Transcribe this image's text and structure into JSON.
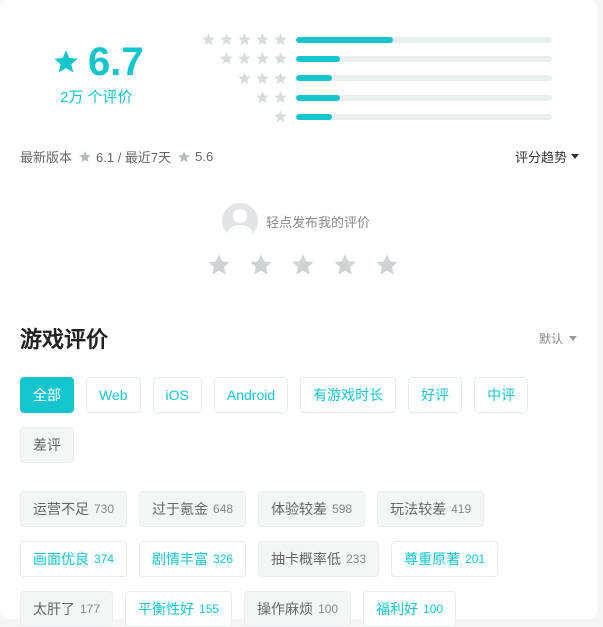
{
  "summary": {
    "score": "6.7",
    "count": "2万 个评价",
    "distribution": [
      {
        "stars": 5,
        "fill": 0.38
      },
      {
        "stars": 4,
        "fill": 0.17
      },
      {
        "stars": 3,
        "fill": 0.14
      },
      {
        "stars": 2,
        "fill": 0.17
      },
      {
        "stars": 1,
        "fill": 0.14
      }
    ]
  },
  "meta": {
    "latest_label": "最新版本",
    "latest_score": "6.1 / 最近7天",
    "recent_score": "5.6",
    "trend_label": "评分趋势"
  },
  "publish": {
    "text": "轻点发布我的评价"
  },
  "reviews": {
    "title": "游戏评价",
    "sort_label": "默认",
    "filters": [
      {
        "label": "全部",
        "style": "active"
      },
      {
        "label": "Web",
        "style": "pos"
      },
      {
        "label": "iOS",
        "style": "pos"
      },
      {
        "label": "Android",
        "style": "pos"
      },
      {
        "label": "有游戏时长",
        "style": "pos"
      },
      {
        "label": "好评",
        "style": "pos"
      },
      {
        "label": "中评",
        "style": "pos"
      },
      {
        "label": "差评",
        "style": "neg"
      }
    ],
    "tags": [
      {
        "label": "运营不足",
        "count": "730",
        "style": "neg"
      },
      {
        "label": "过于氪金",
        "count": "648",
        "style": "neg"
      },
      {
        "label": "体验较差",
        "count": "598",
        "style": "neg"
      },
      {
        "label": "玩法较差",
        "count": "419",
        "style": "neg"
      },
      {
        "label": "画面优良",
        "count": "374",
        "style": "pos"
      },
      {
        "label": "剧情丰富",
        "count": "326",
        "style": "pos"
      },
      {
        "label": "抽卡概率低",
        "count": "233",
        "style": "neg"
      },
      {
        "label": "尊重原著",
        "count": "201",
        "style": "pos"
      },
      {
        "label": "太肝了",
        "count": "177",
        "style": "neg"
      },
      {
        "label": "平衡性好",
        "count": "155",
        "style": "pos"
      },
      {
        "label": "操作麻烦",
        "count": "100",
        "style": "neg"
      },
      {
        "label": "福利好",
        "count": "100",
        "style": "pos"
      }
    ]
  },
  "colors": {
    "accent": "#15c5ce",
    "star_gray": "#d9dcdd"
  },
  "icons": {
    "star": "star-icon",
    "avatar": "user-avatar-icon",
    "caret": "caret-down-icon"
  }
}
